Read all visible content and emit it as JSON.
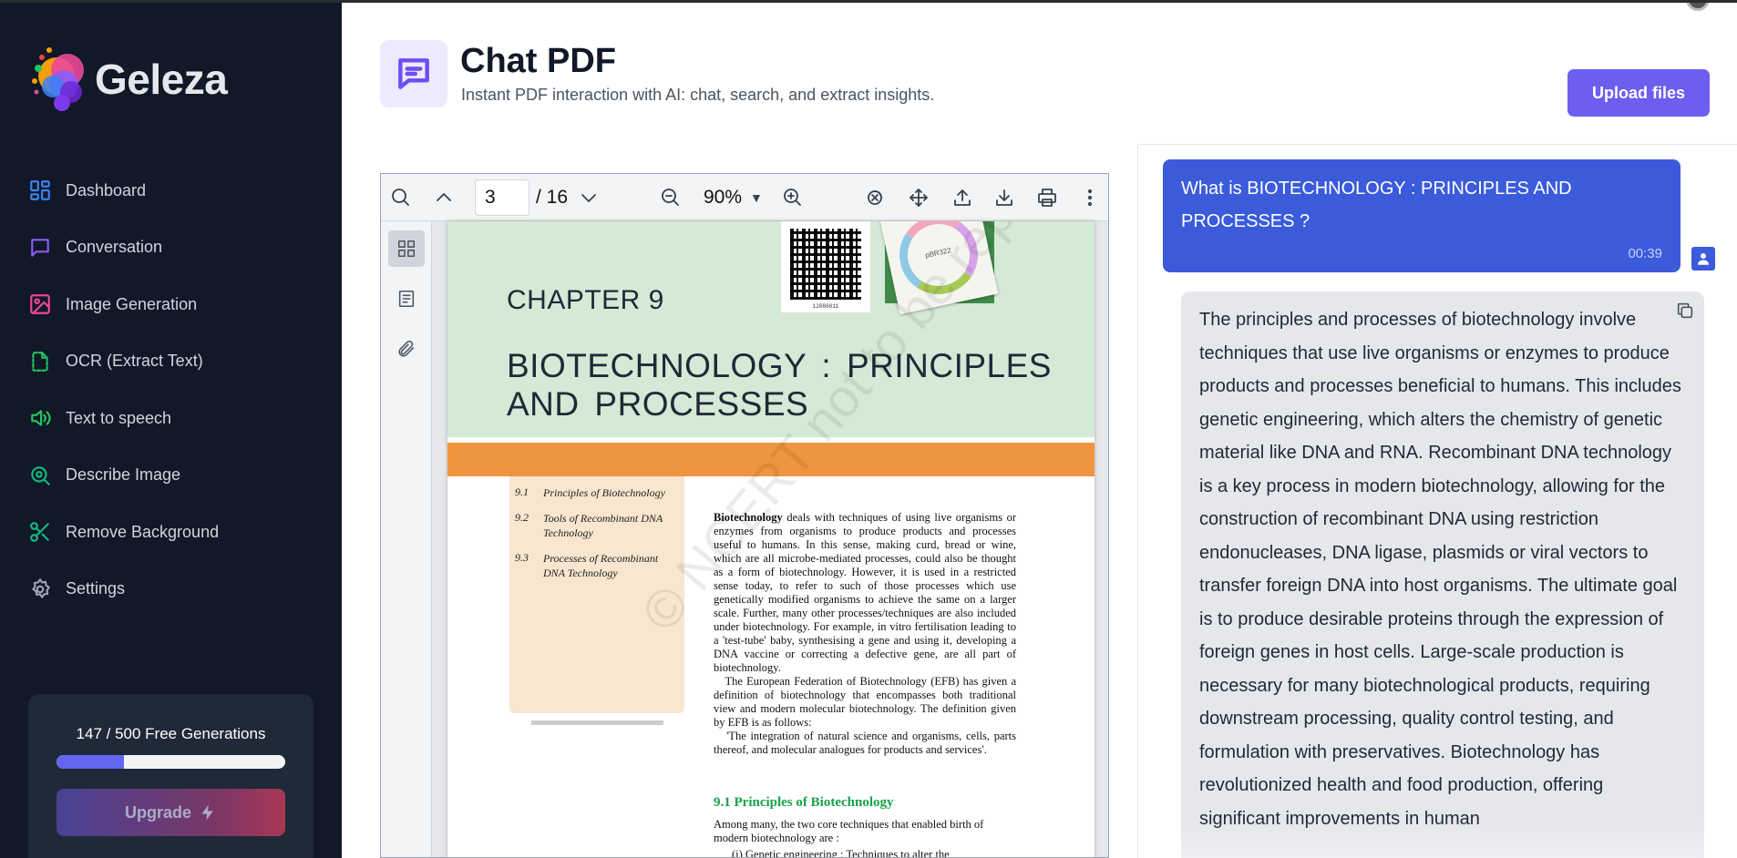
{
  "brand": {
    "name": "Geleza"
  },
  "sidebar": {
    "items": [
      {
        "label": "Dashboard",
        "icon": "grid-icon",
        "color": "#3b82f6"
      },
      {
        "label": "Conversation",
        "icon": "chat-icon",
        "color": "#8b5cf6"
      },
      {
        "label": "Image Generation",
        "icon": "image-icon",
        "color": "#ec4899"
      },
      {
        "label": "OCR (Extract Text)",
        "icon": "document-scan-icon",
        "color": "#22c55e"
      },
      {
        "label": "Text to speech",
        "icon": "speaker-icon",
        "color": "#22c55e"
      },
      {
        "label": "Describe Image",
        "icon": "search-image-icon",
        "color": "#10b981"
      },
      {
        "label": "Remove Background",
        "icon": "scissors-icon",
        "color": "#10b981"
      },
      {
        "label": "Settings",
        "icon": "gear-icon",
        "color": "#9ca3af"
      }
    ],
    "generations": {
      "text": "147 / 500 Free Generations",
      "used": 147,
      "total": 500
    },
    "upgrade_label": "Upgrade"
  },
  "header": {
    "title": "Chat PDF",
    "subtitle": "Instant PDF interaction with AI: chat, search, and extract insights.",
    "upload_label": "Upload files"
  },
  "pdf": {
    "current_page": "3",
    "total_pages": "/ 16",
    "zoom": "90%",
    "page": {
      "chapter": "CHAPTER 9",
      "title": "BIOTECHNOLOGY : PRINCIPLES AND PROCESSES",
      "qr_number": "12080811",
      "plasmid_label": "pBR322",
      "toc": [
        {
          "num": "9.1",
          "text": "Principles of Biotechnology"
        },
        {
          "num": "9.2",
          "text": "Tools of Recombinant DNA Technology"
        },
        {
          "num": "9.3",
          "text": "Processes of Recombinant DNA Technology"
        }
      ],
      "body_lead": "Biotechnology",
      "body": "deals with techniques of using live organisms or enzymes from organisms to produce products and processes useful to humans. In this sense, making curd, bread or wine, which are all microbe-mediated processes, could also be thought as a form of biotechnology. However, it is used in a restricted sense today, to refer to such of those processes which use genetically modified organisms to achieve the same on a larger scale. Further, many other processes/techniques are also included under biotechnology. For example, in vitro fertilisation leading to a 'test-tube' baby, synthesising a gene and using it, developing a DNA vaccine or correcting a defective gene, are all part of biotechnology.",
      "body_p2": "The European Federation of Biotechnology (EFB) has given a definition of biotechnology that encompasses both traditional view and modern molecular biotechnology. The definition given by EFB is as follows:",
      "body_quote": "'The integration of natural science and organisms, cells, parts thereof, and molecular analogues for products and services'.",
      "section": "9.1 Principles of Biotechnology",
      "section_body": "Among many, the two core techniques that enabled birth of modern biotechnology are :",
      "list_item": "(i)   Genetic engineering : Techniques to alter the",
      "watermark": "© NCERT not to be republished"
    }
  },
  "chat": {
    "user_message": "What is BIOTECHNOLOGY : PRINCIPLES AND PROCESSES ?",
    "user_time": "00:39",
    "bot_message": "The principles and processes of biotechnology involve techniques that use live organisms or enzymes to produce products and processes beneficial to humans. This includes genetic engineering, which alters the chemistry of genetic material like DNA and RNA. Recombinant DNA technology is a key process in modern biotechnology, allowing for the construction of recombinant DNA using restriction endonucleases, DNA ligase, plasmids or viral vectors to transfer foreign DNA into host organisms. The ultimate goal is to produce desirable proteins through the expression of foreign genes in host cells. Large-scale production is necessary for many biotechnological products, requiring downstream processing, quality control testing, and formulation with preservatives. Biotechnology has revolutionized health and food production, offering significant improvements in human"
  },
  "colors": {
    "accent": "#6d5ef0",
    "user_bubble": "#3b5bdb",
    "sidebar_bg": "#111827"
  }
}
